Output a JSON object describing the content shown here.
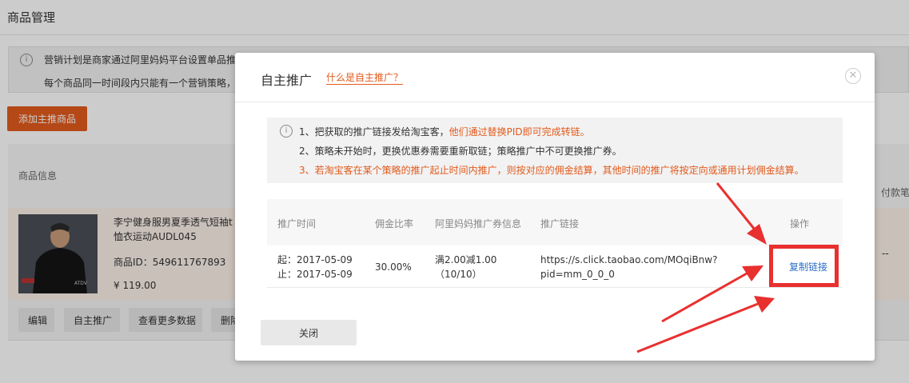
{
  "page": {
    "title": "商品管理",
    "notice": {
      "line1": "营销计划是商家通过阿里妈妈平台设置单品推",
      "line2": "每个商品同一时间段内只能有一个营销策略，"
    },
    "add_button": "添加主推商品",
    "table": {
      "col_goods": "商品信息",
      "col_pay": "付款笔",
      "row": {
        "title": "李宁健身服男夏季透气短袖t恤衣运动AUDL045",
        "id": "商品ID：549611767893",
        "price": "¥ 119.00",
        "dash": "--"
      }
    },
    "actions": [
      "编辑",
      "自主推广",
      "查看更多数据",
      "删除"
    ]
  },
  "modal": {
    "title": "自主推广",
    "help_link": "什么是自主推广？",
    "tips": {
      "line1_a": "1、把获取的推广链接发给淘宝客，",
      "line1_b": "他们通过替换PID即可完成转链。",
      "line2": "2、策略未开始时，更换优惠券需要重新取链；策略推广中不可更换推广券。",
      "line3": "3、若淘宝客在某个策略的推广起止时间内推广，则按对应的佣金结算，其他时间的推广将按定向或通用计划佣金结算。"
    },
    "table": {
      "headers": [
        "推广时间",
        "佣金比率",
        "阿里妈妈推广券信息",
        "推广链接",
        "操作"
      ],
      "row": {
        "start": "起：2017-05-09",
        "end": "止：2017-05-09",
        "rate": "30.00%",
        "coupon_line1": "满2.00减1.00",
        "coupon_line2": "（10/10）",
        "link_line1": "https://s.click.taobao.com/MOqiBnw?",
        "link_line2": "pid=mm_0_0_0",
        "action": "复制链接"
      }
    },
    "close_button": "关闭"
  },
  "colors": {
    "accent": "#e25a1c",
    "link": "#2b6ec9",
    "annotation": "#e8302f"
  }
}
